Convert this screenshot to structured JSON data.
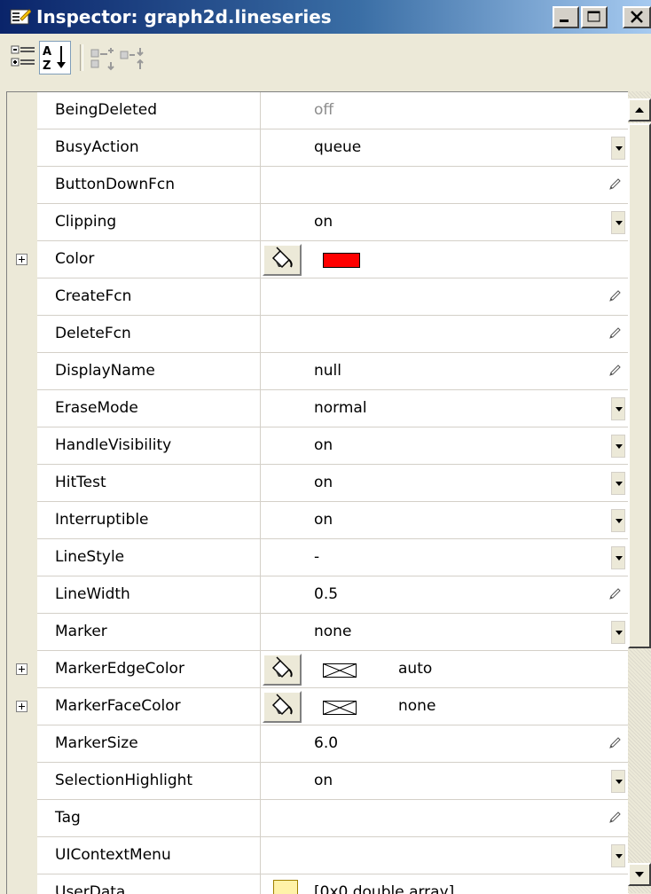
{
  "window": {
    "title": "Inspector: graph2d.lineseries"
  },
  "toolbar": {
    "tools": [
      {
        "name": "categorized-view-icon",
        "selected": false
      },
      {
        "name": "alphabetical-sort-icon",
        "selected": true
      },
      {
        "name": "expand-all-icon",
        "selected": false
      },
      {
        "name": "collapse-all-icon",
        "selected": false
      }
    ]
  },
  "properties": [
    {
      "name": "BeingDeleted",
      "value": "off",
      "editor": "none",
      "disabled": true
    },
    {
      "name": "BusyAction",
      "value": "queue",
      "editor": "dropdown"
    },
    {
      "name": "ButtonDownFcn",
      "value": "",
      "editor": "pencil"
    },
    {
      "name": "Clipping",
      "value": "on",
      "editor": "dropdown"
    },
    {
      "name": "Color",
      "value": "",
      "editor": "color",
      "expandable": true,
      "swatch": "#ff0000"
    },
    {
      "name": "CreateFcn",
      "value": "",
      "editor": "pencil"
    },
    {
      "name": "DeleteFcn",
      "value": "",
      "editor": "pencil"
    },
    {
      "name": "DisplayName",
      "value": "null",
      "editor": "pencil"
    },
    {
      "name": "EraseMode",
      "value": "normal",
      "editor": "dropdown"
    },
    {
      "name": "HandleVisibility",
      "value": "on",
      "editor": "dropdown"
    },
    {
      "name": "HitTest",
      "value": "on",
      "editor": "dropdown"
    },
    {
      "name": "Interruptible",
      "value": "on",
      "editor": "dropdown"
    },
    {
      "name": "LineStyle",
      "value": "-",
      "editor": "dropdown"
    },
    {
      "name": "LineWidth",
      "value": "0.5",
      "editor": "pencil"
    },
    {
      "name": "Marker",
      "value": "none",
      "editor": "dropdown"
    },
    {
      "name": "MarkerEdgeColor",
      "value": "auto",
      "editor": "colorenv",
      "expandable": true
    },
    {
      "name": "MarkerFaceColor",
      "value": "none",
      "editor": "colorenv",
      "expandable": true
    },
    {
      "name": "MarkerSize",
      "value": "6.0",
      "editor": "pencil"
    },
    {
      "name": "SelectionHighlight",
      "value": "on",
      "editor": "dropdown"
    },
    {
      "name": "Tag",
      "value": "",
      "editor": "pencil"
    },
    {
      "name": "UIContextMenu",
      "value": "",
      "editor": "dropdown"
    },
    {
      "name": "UserData",
      "value": "[0x0 double array]",
      "editor": "folder"
    }
  ],
  "colors": {
    "titlebar_start": "#0a246a",
    "titlebar_end": "#a6caf0",
    "color_swatch": "#ff0000"
  }
}
